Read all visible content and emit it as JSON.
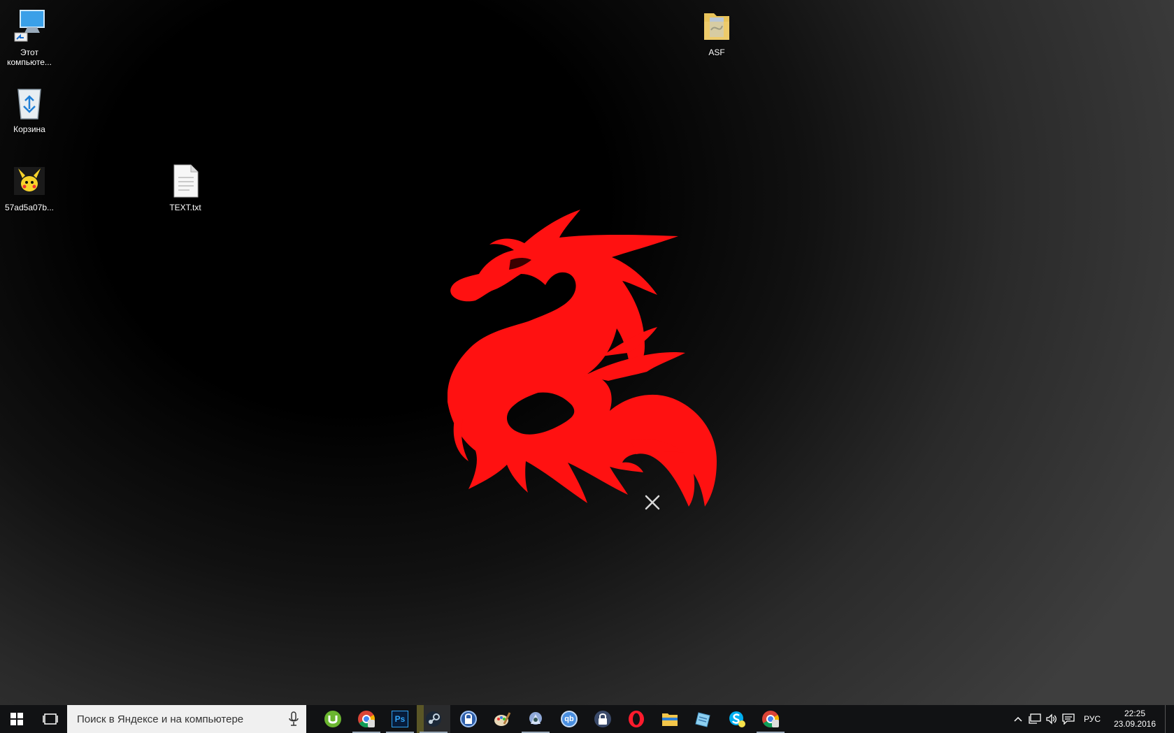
{
  "desktop_icons": [
    {
      "label": "Этот компьюте...",
      "icon": "computer-icon"
    },
    {
      "label": "Корзина",
      "icon": "recycle-bin-icon"
    },
    {
      "label": "57ad5a07b...",
      "icon": "image-file-icon"
    },
    {
      "label": "TEXT.txt",
      "icon": "text-file-icon"
    },
    {
      "label": "ASF",
      "icon": "folder-icon"
    }
  ],
  "wallpaper": {
    "accent": "#ff1111"
  },
  "taskbar": {
    "search_placeholder": "Поиск в Яндексе и на компьютере",
    "pinned": [
      "utorrent-icon",
      "chrome-icon",
      "photoshop-icon",
      "steam-icon",
      "vpn-icon",
      "paint-icon",
      "game-icon",
      "qbittorrent-icon",
      "lock-icon",
      "opera-icon",
      "file-explorer-icon",
      "notepad-icon",
      "skype-icon",
      "chrome-user-icon"
    ],
    "photoshop_label": "Ps",
    "qb_label": "qb",
    "tray_language": "РУС",
    "clock_time": "22:25",
    "clock_date": "23.09.2016"
  }
}
